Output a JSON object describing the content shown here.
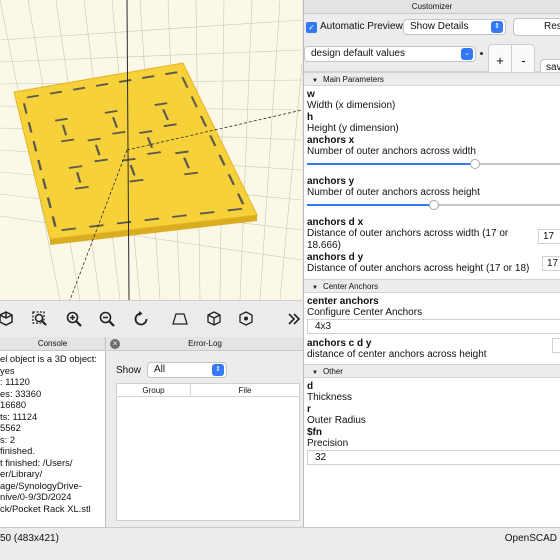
{
  "customizer": {
    "panel_title": "Customizer",
    "automatic_preview_label": "Automatic Preview",
    "show_details_value": "Show Details",
    "reset_label": "Rese",
    "preset_value": "design default values",
    "plus_label": "+",
    "minus_label": "-",
    "save_label": "save",
    "groups": [
      {
        "title": "Main Parameters"
      },
      {
        "title": "Center Anchors"
      },
      {
        "title": "Other"
      }
    ],
    "params": {
      "w": {
        "name": "w",
        "desc": "Width (x dimension)"
      },
      "h": {
        "name": "h",
        "desc": "Height (y dimension)"
      },
      "anchors_x": {
        "name": "anchors x",
        "desc": "Number of outer anchors across width",
        "slider_fraction": 0.66
      },
      "anchors_y": {
        "name": "anchors y",
        "desc": "Number of outer anchors across height",
        "slider_fraction": 0.5
      },
      "anchors_d_x": {
        "name": "anchors d x",
        "desc_line1": "Distance of outer anchors across width (17 or",
        "desc_line2": "18.666)",
        "value": "17"
      },
      "anchors_d_y": {
        "name": "anchors d y",
        "desc": "Distance of outer anchors across height (17 or 18)",
        "value": "17"
      },
      "center_anchors": {
        "name": "center anchors",
        "desc": "Configure Center Anchors",
        "value": "4x3"
      },
      "anchors_c_d_y": {
        "name": "anchors c d y",
        "desc": "distance of center anchors across height"
      },
      "d": {
        "name": "d",
        "desc": "Thickness"
      },
      "r": {
        "name": "r",
        "desc": "Outer Radius"
      },
      "fn": {
        "name": "$fn",
        "desc": "Precision",
        "value": "32"
      }
    }
  },
  "console": {
    "title": "Console",
    "lines": [
      "el object is a 3D object:",
      "         yes",
      ":    11120",
      "es:   33360",
      "       16680",
      "ts:   11124",
      "        5562",
      "s:       2",
      " finished.",
      "t finished: /Users/",
      "er/Library/",
      "age/SynologyDrive-",
      "nive/0-9/3D/2024",
      "ck/Pocket Rack XL.stl"
    ]
  },
  "errorlog": {
    "title": "Error-Log",
    "show_label": "Show",
    "filter_value": "All",
    "columns": [
      "Group",
      "File"
    ]
  },
  "statusbar": {
    "left_text": "50 (483x421)",
    "right_text": "OpenSCAD"
  },
  "toolbar": {
    "icons": [
      "view-all-icon",
      "zoom-fit-icon",
      "zoom-in-icon",
      "zoom-out-icon",
      "reset-view-icon",
      "perspective-icon",
      "orthogonal-icon",
      "show-axes-icon",
      "more-icon"
    ]
  },
  "colors": {
    "model_yellow": "#f7d13a",
    "accent_blue": "#3478f6",
    "viewport_bg": "#fbf8e8"
  }
}
